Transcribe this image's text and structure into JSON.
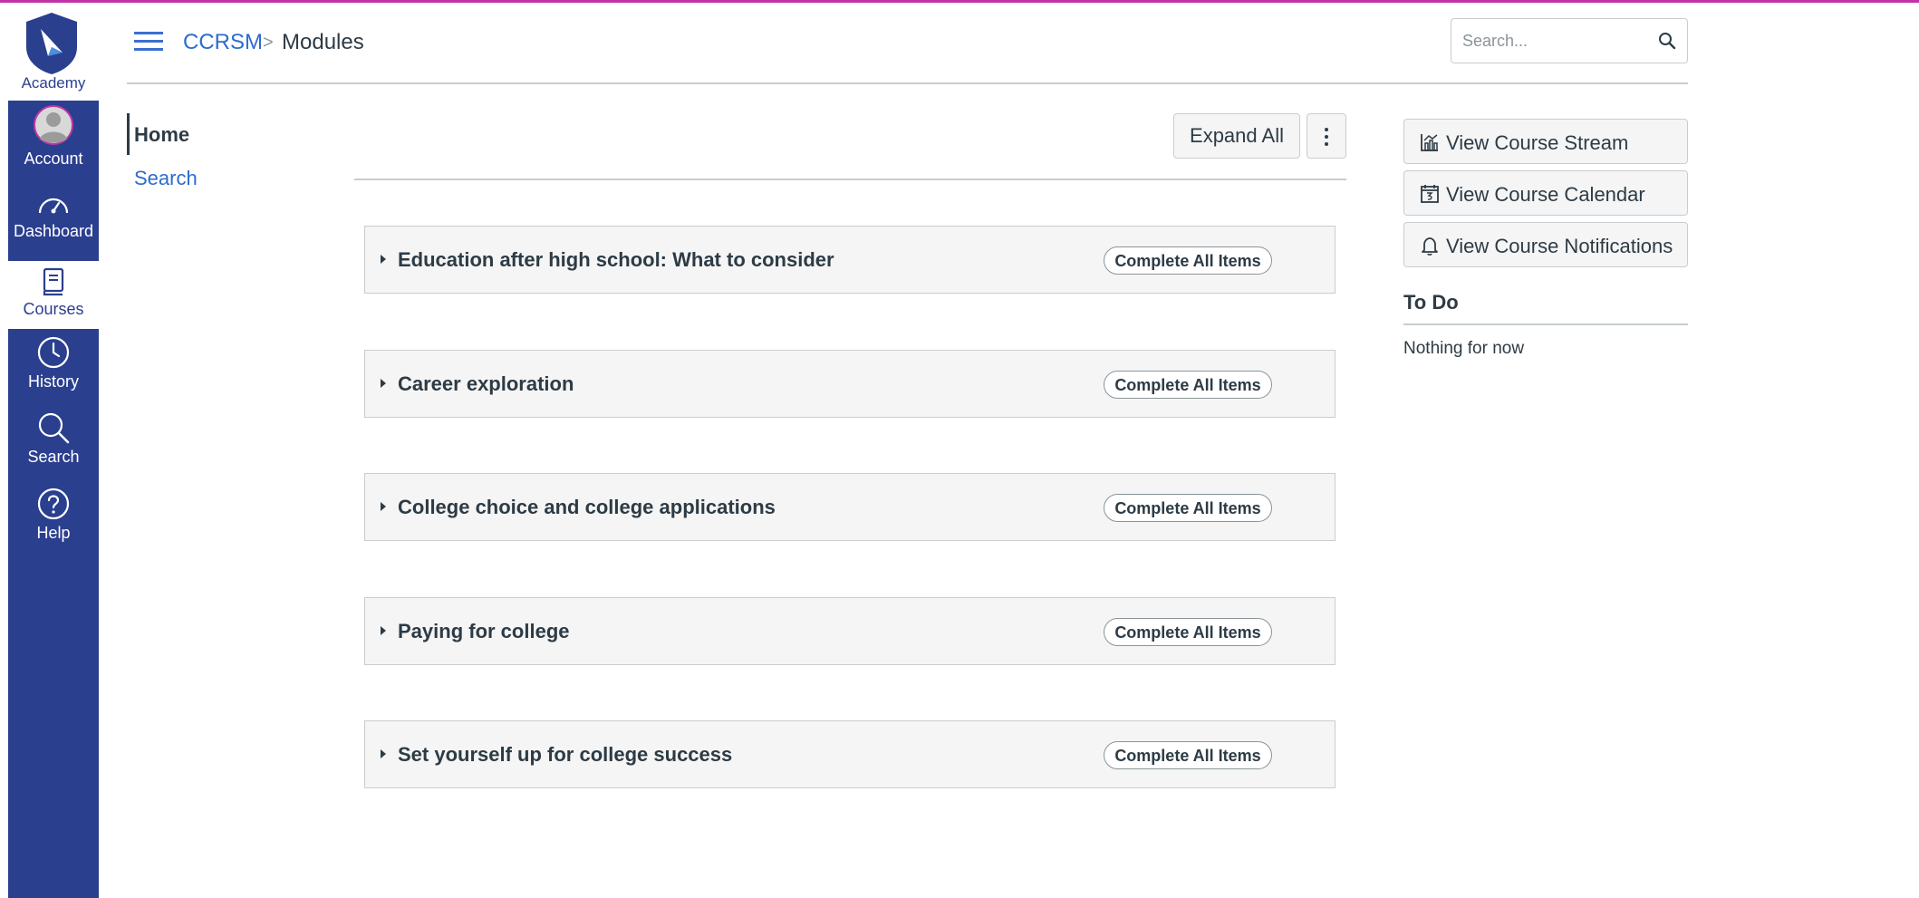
{
  "brand": {
    "name": "Academy",
    "logo_icon": "compass-shield-logo"
  },
  "global_nav": [
    {
      "key": "account",
      "label": "Account",
      "icon": "avatar-icon",
      "active": false
    },
    {
      "key": "dashboard",
      "label": "Dashboard",
      "icon": "speedometer-icon",
      "active": false
    },
    {
      "key": "courses",
      "label": "Courses",
      "icon": "book-icon",
      "active": true
    },
    {
      "key": "history",
      "label": "History",
      "icon": "clock-icon",
      "active": false
    },
    {
      "key": "search",
      "label": "Search",
      "icon": "magnifier-icon",
      "active": false
    },
    {
      "key": "help",
      "label": "Help",
      "icon": "question-circle-icon",
      "active": false
    }
  ],
  "breadcrumb": {
    "course": "CCRSM",
    "separator": ">",
    "current": "Modules"
  },
  "search": {
    "placeholder": "Search..."
  },
  "course_nav": {
    "items": [
      {
        "label": "Home",
        "active": true
      },
      {
        "label": "Search",
        "active": false
      }
    ]
  },
  "toolbar": {
    "expand_label": "Expand All"
  },
  "modules": [
    {
      "title": "Education after high school: What to consider",
      "action": "Complete All Items"
    },
    {
      "title": "Career exploration",
      "action": "Complete All Items"
    },
    {
      "title": "College choice and college applications",
      "action": "Complete All Items"
    },
    {
      "title": "Paying for college",
      "action": "Complete All Items"
    },
    {
      "title": "Set yourself up for college success",
      "action": "Complete All Items"
    }
  ],
  "sidebar": {
    "buttons": [
      {
        "label": "View Course Stream",
        "icon": "stream-chart-icon"
      },
      {
        "label": "View Course Calendar",
        "icon": "calendar-icon"
      },
      {
        "label": "View Course Notifications",
        "icon": "bell-icon"
      }
    ],
    "todo_heading": "To Do",
    "todo_empty": "Nothing for now"
  },
  "colors": {
    "nav_bg": "#2b3f8f",
    "link": "#2d6bcf",
    "accent_bar": "#c034a8",
    "text": "#2d3b45"
  }
}
